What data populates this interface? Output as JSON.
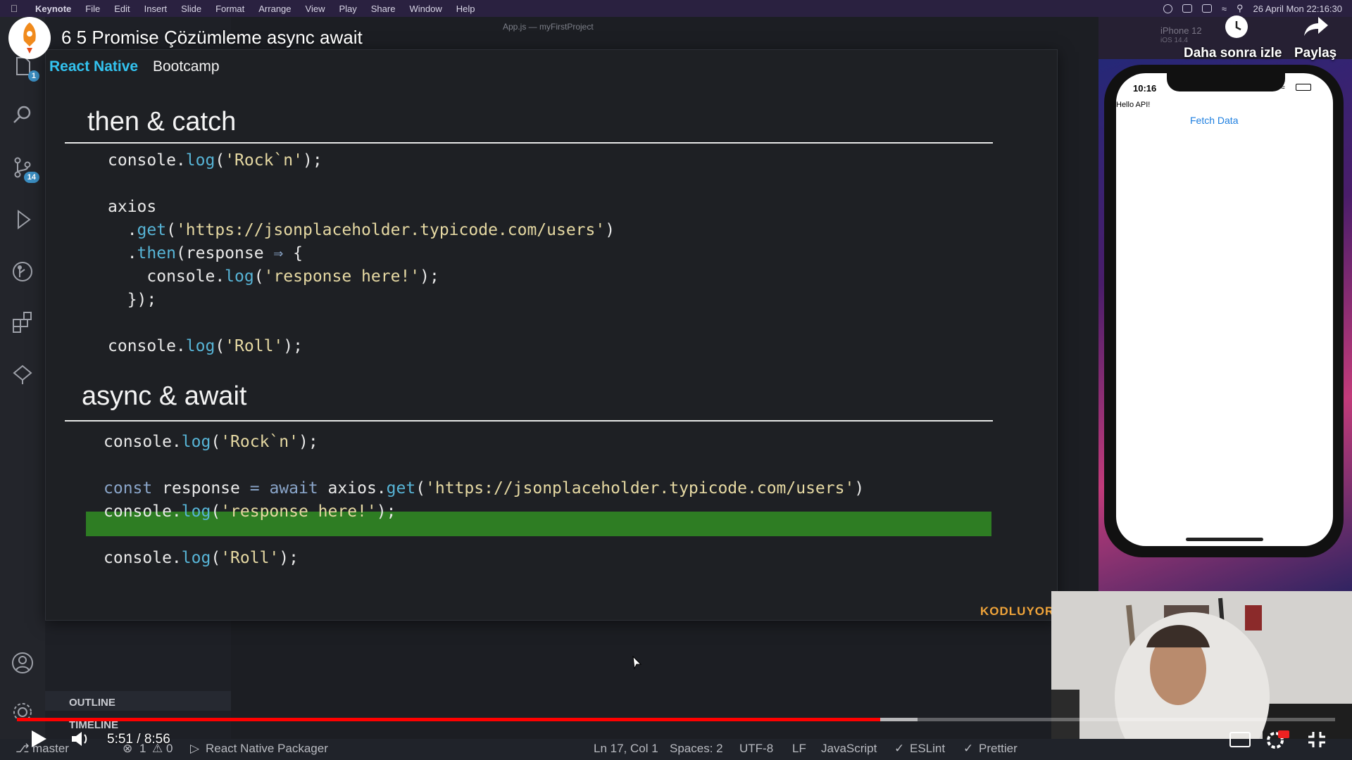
{
  "menubar": {
    "app": "Keynote",
    "items": [
      "File",
      "Edit",
      "Insert",
      "Slide",
      "Format",
      "Arrange",
      "View",
      "Play",
      "Share",
      "Window",
      "Help"
    ],
    "datetime": "26 April Mon  22:16:30"
  },
  "editor": {
    "window_title": "App.js — myFirstProject"
  },
  "activity": {
    "explorer_badge": "1",
    "scm_badge": "14"
  },
  "video": {
    "title": "6 5 Promise Çözümleme async await",
    "watch_later": "Daha sonra izle",
    "share": "Paylaş",
    "current_time": "5:51",
    "duration": "8:56",
    "time_display": "5:51 / 8:56",
    "progress_fraction": 0.655,
    "buffered_fraction": 0.683
  },
  "slide": {
    "brand_primary": "React Native",
    "brand_secondary": "Bootcamp",
    "section1_title": "then & catch",
    "section2_title": "async & await",
    "watermark": "KODLUYORUZ",
    "accent_color": "#33c3f0",
    "highlight_color": "#2e7d23"
  },
  "sidebar": {
    "outline": "OUTLINE",
    "timeline": "TIMELINE"
  },
  "simulator": {
    "device": "iPhone 12",
    "os": "iOS 14.4",
    "time": "10:16",
    "hello_text": "Hello API!",
    "fetch_button": "Fetch Data"
  },
  "statusbar": {
    "branch": "master",
    "errors": "1",
    "warnings": "0",
    "packager": "React Native Packager",
    "position": "Ln 17, Col 1",
    "spaces": "Spaces: 2",
    "encoding": "UTF-8",
    "eol": "LF",
    "language": "JavaScript",
    "eslint": "ESLint",
    "prettier": "Prettier"
  },
  "icons": [
    "apple-icon",
    "explorer-icon",
    "search-icon",
    "source-control-icon",
    "run-debug-icon",
    "git-graph-icon",
    "extensions-icon",
    "remote-explorer-icon",
    "account-icon",
    "settings-icon",
    "play-icon",
    "volume-icon",
    "subtitles-icon",
    "settings-hd-icon",
    "exit-fullscreen-icon",
    "clock-icon",
    "share-icon"
  ]
}
